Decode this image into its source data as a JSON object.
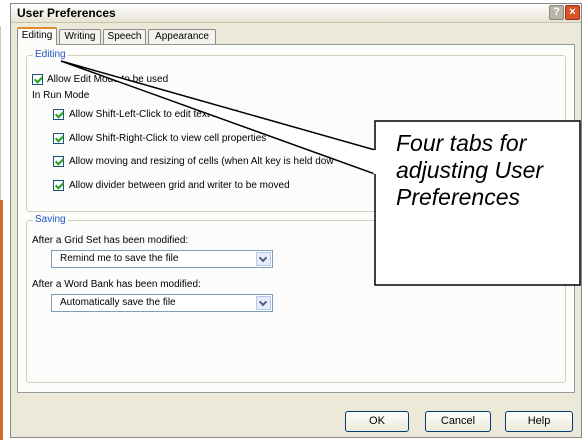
{
  "window": {
    "title": "User Preferences"
  },
  "tabs": [
    {
      "label": "Editing",
      "active": true
    },
    {
      "label": "Writing",
      "active": false
    },
    {
      "label": "Speech",
      "active": false
    },
    {
      "label": "Appearance",
      "active": false
    }
  ],
  "editing": {
    "legend": "Editing",
    "allow_edit_mode": "Allow Edit Mode to be used",
    "run_mode_label": "In Run Mode",
    "options": [
      "Allow Shift-Left-Click to edit text in cells",
      "Allow Shift-Right-Click to view cell properties",
      "Allow moving and resizing of cells (when Alt key is held dow",
      "Allow divider between grid and writer to be moved"
    ]
  },
  "saving": {
    "legend": "Saving",
    "grid_set_label": "After a Grid Set has been modified:",
    "grid_set_value": "Remind me to save the file",
    "word_bank_label": "After a Word Bank has been modified:",
    "word_bank_value": "Automatically save the file"
  },
  "buttons": {
    "ok": "OK",
    "cancel": "Cancel",
    "help": "Help"
  },
  "titlebar": {
    "help_glyph": "?",
    "close_glyph": "×"
  },
  "callout": {
    "text": "Four tabs for adjusting User Preferences"
  },
  "colors": {
    "legend": "#2153c5",
    "active_tab_accent": "#e68b2c",
    "close_button": "#d9532b"
  }
}
